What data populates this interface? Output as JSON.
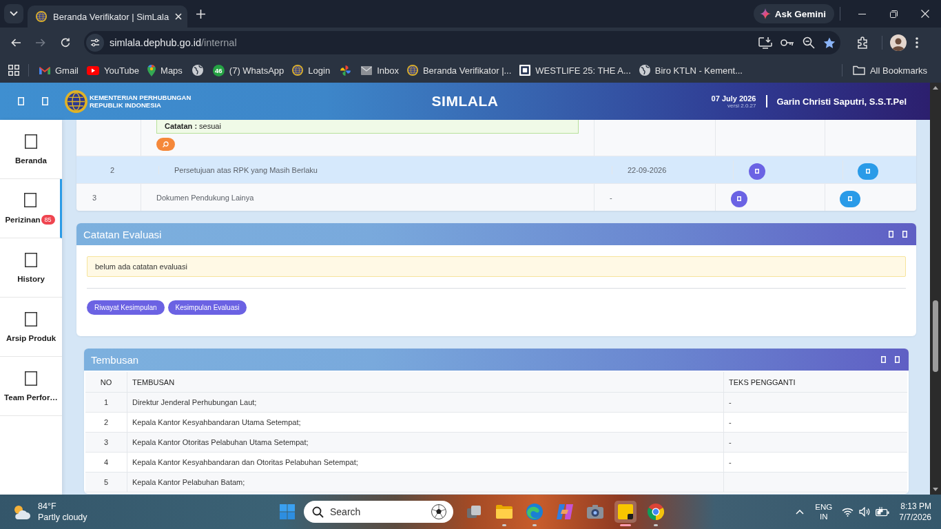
{
  "browser": {
    "tab": {
      "title": "Beranda Verifikator | SimLala"
    },
    "ask_gemini": "Ask Gemini",
    "address": {
      "host": "simlala.dephub.go.id",
      "path": "/internal"
    },
    "starred": true,
    "bookmarks": [
      {
        "kind": "mail",
        "label": "Gmail"
      },
      {
        "kind": "video",
        "label": "YouTube"
      },
      {
        "kind": "map_pin",
        "label": "Maps"
      },
      {
        "kind": "globe"
      },
      {
        "kind": "chat",
        "badge": "46",
        "label": "(7) WhatsApp"
      },
      {
        "kind": "emblem",
        "label": "Login"
      },
      {
        "kind": "pinwheel"
      },
      {
        "kind": "envelope",
        "label": "Inbox"
      },
      {
        "kind": "emblem",
        "label": "Beranda Verifikator |..."
      },
      {
        "kind": "square_logo",
        "label": "WESTLIFE 25: THE A..."
      },
      {
        "kind": "globe",
        "label": "Biro KTLN - Kement..."
      }
    ],
    "all_bookmarks": "All Bookmarks"
  },
  "app": {
    "header": {
      "org": [
        "KEMENTERIAN PERHUBUNGAN",
        "REPUBLIK INDONESIA"
      ],
      "title": "SIMLALA",
      "date": "07 July 2026",
      "version": "versi 2.0.27",
      "user": "Garin Christi Saputri, S.S.T.Pel"
    },
    "sidebar": [
      {
        "label": "Beranda",
        "selected": false
      },
      {
        "label": "Perizinan",
        "selected": true,
        "badge": "85"
      },
      {
        "label": "History",
        "selected": false
      },
      {
        "label": "Arsip Produk",
        "selected": false
      },
      {
        "label": "Team Perfor…",
        "selected": false
      }
    ],
    "documents": {
      "partial_note": "**Catatan :** sesuai",
      "rows": [
        {
          "no": "2",
          "name": "Persetujuan atas RPK yang Masih Berlaku",
          "date": "22-09-2026",
          "highlighted": true
        },
        {
          "no": "3",
          "name": "Dokumen Pendukung Lainya",
          "date": "-",
          "highlighted": false
        }
      ]
    },
    "evaluation": {
      "title": "Catatan Evaluasi",
      "message": "belum ada catatan evaluasi",
      "buttons": [
        "Riwayat Kesimpulan",
        "Kesimpulan Evaluasi"
      ]
    },
    "copies": {
      "title": "Tembusan",
      "columns": [
        "NO",
        "TEMBUSAN",
        "TEKS PENGGANTI"
      ],
      "rows": [
        {
          "no": "1",
          "recipient": "Direktur Jenderal Perhubungan Laut;",
          "replacement": "-"
        },
        {
          "no": "2",
          "recipient": "Kepala Kantor Kesyahbandaran Utama Setempat;",
          "replacement": "-"
        },
        {
          "no": "3",
          "recipient": "Kepala Kantor Otoritas Pelabuhan Utama Setempat;",
          "replacement": "-"
        },
        {
          "no": "4",
          "recipient": "Kepala Kantor Kesyahbandaran dan Otoritas Pelabuhan Setempat;",
          "replacement": "-"
        },
        {
          "no": "5",
          "recipient": "Kepala Kantor Pelabuhan Batam;"
        }
      ]
    }
  },
  "taskbar": {
    "weather": {
      "temperature": "84°F",
      "condition": "Partly cloudy"
    },
    "search": {
      "placeholder": "Search"
    },
    "apps": [
      {
        "kind": "window_stack",
        "running": false,
        "selected": false
      },
      {
        "kind": "folder",
        "running": true,
        "selected": false
      },
      {
        "kind": "wave",
        "running": true,
        "selected": false
      },
      {
        "kind": "ribbon",
        "running": false,
        "selected": false
      },
      {
        "kind": "camera",
        "running": false,
        "selected": false
      },
      {
        "kind": "note",
        "running": true,
        "selected": true
      },
      {
        "kind": "tricolor",
        "running": true,
        "selected": false
      }
    ],
    "language": "ENG",
    "region": "IN",
    "time": "8:13 PM",
    "date": "7/7/2026"
  }
}
